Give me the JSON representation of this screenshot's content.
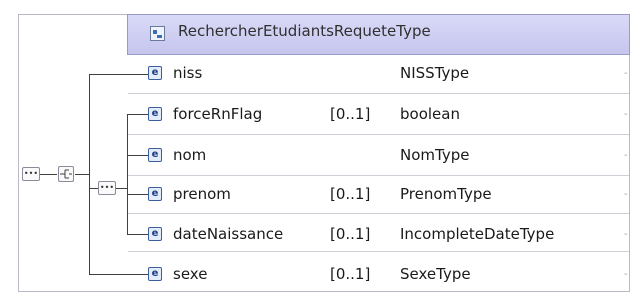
{
  "type_name": "RechercherEtudiantsRequeteType",
  "type_icon": "complex-type-icon",
  "element_icon_glyph": "e",
  "compositor_glyph": "•••",
  "edge_tick": "-",
  "elements": [
    {
      "name": "niss",
      "cardinality": "",
      "type": "NISSType"
    },
    {
      "name": "forceRnFlag",
      "cardinality": "[0..1]",
      "type": "boolean"
    },
    {
      "name": "nom",
      "cardinality": "",
      "type": "NomType"
    },
    {
      "name": "prenom",
      "cardinality": "[0..1]",
      "type": "PrenomType"
    },
    {
      "name": "dateNaissance",
      "cardinality": "[0..1]",
      "type": "IncompleteDateType"
    },
    {
      "name": "sexe",
      "cardinality": "[0..1]",
      "type": "SexeType"
    }
  ],
  "colors": {
    "header_fill": "#c6c6ee",
    "element_icon": "#3a5f9c",
    "frame_border": "#b9b9c8"
  }
}
